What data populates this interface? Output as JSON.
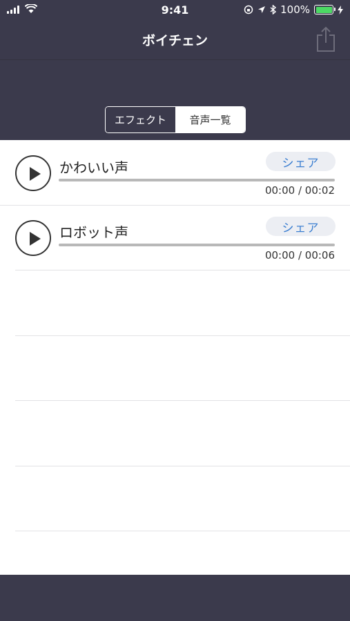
{
  "status_bar": {
    "time": "9:41",
    "battery_percent": "100%"
  },
  "nav": {
    "title": "ボイチェン"
  },
  "segments": [
    {
      "label": "エフェクト",
      "selected": true
    },
    {
      "label": "音声一覧",
      "selected": false
    }
  ],
  "items": [
    {
      "title": "かわいい声",
      "share_label": "シェア",
      "time": "00:00 / 00:02",
      "progress": 0
    },
    {
      "title": "ロボット声",
      "share_label": "シェア",
      "time": "00:00 / 00:06",
      "progress": 0
    }
  ],
  "colors": {
    "nav_bg": "#3b3a4c",
    "share_text": "#3c7fd1",
    "share_bg": "#eceef3",
    "battery": "#4cd964"
  }
}
